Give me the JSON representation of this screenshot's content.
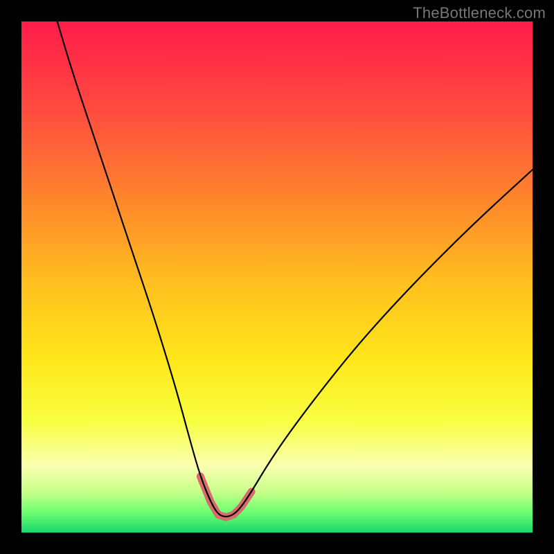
{
  "watermark": "TheBottleneck.com",
  "colors": {
    "page_bg": "#000000",
    "curve": "#000000",
    "highlight": "#d86b6b",
    "gradient_stops": [
      {
        "pct": 0,
        "color": "#ff1c4a"
      },
      {
        "pct": 18,
        "color": "#ff4d3f"
      },
      {
        "pct": 36,
        "color": "#ff8a2a"
      },
      {
        "pct": 52,
        "color": "#ffc21f"
      },
      {
        "pct": 66,
        "color": "#ffe61a"
      },
      {
        "pct": 78,
        "color": "#f8ff40"
      },
      {
        "pct": 87,
        "color": "#faffb0"
      },
      {
        "pct": 92,
        "color": "#c8ff8a"
      },
      {
        "pct": 96,
        "color": "#6dff70"
      },
      {
        "pct": 100,
        "color": "#19d66b"
      }
    ]
  },
  "chart_data": {
    "type": "line",
    "title": "",
    "xlabel": "",
    "ylabel": "",
    "xlim": [
      0,
      100
    ],
    "ylim": [
      0,
      100
    ],
    "note": "Bottleneck-style V-curve; y≈100 = worst fit (red), y≈0 = best fit (green). Minimum around x≈38–42.",
    "series": [
      {
        "name": "bottleneck-curve",
        "x": [
          7,
          10,
          14,
          18,
          22,
          26,
          30,
          33,
          35,
          37,
          38.5,
          40,
          41.5,
          43,
          45,
          48,
          52,
          58,
          66,
          76,
          88,
          100
        ],
        "y": [
          100,
          90,
          78,
          66,
          54,
          42,
          29,
          18,
          11,
          6,
          3.5,
          3,
          3.5,
          5,
          8,
          13,
          19,
          27,
          37,
          48,
          60,
          71
        ]
      }
    ],
    "highlight_range": {
      "x_from": 35,
      "x_to": 45,
      "note": "thick salmon overlay on near-minimum segment"
    }
  }
}
